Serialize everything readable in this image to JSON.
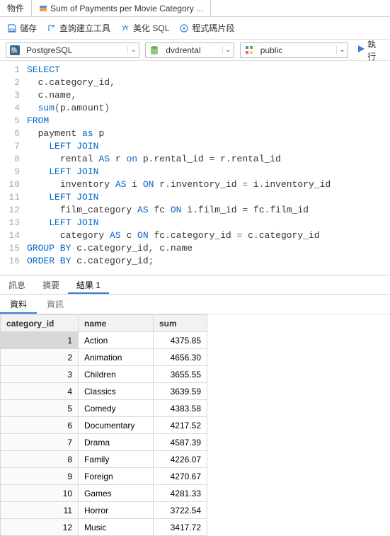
{
  "tabs_top": {
    "items": [
      "物件",
      "Sum of Payments per Movie Category ..."
    ],
    "active": 1
  },
  "toolbar": {
    "save": "儲存",
    "query_builder": "查詢建立工具",
    "beautify": "美化 SQL",
    "snippet": "程式碼片段"
  },
  "dropdowns": {
    "connection": "PostgreSQL",
    "database": "dvdrental",
    "schema": "public"
  },
  "run_label": "執行",
  "sql_lines": [
    [
      [
        "kw",
        "SELECT"
      ]
    ],
    [
      [
        "pad",
        "  "
      ],
      [
        "ident",
        "c"
      ],
      [
        "punc",
        "."
      ],
      [
        "ident",
        "category_id"
      ],
      [
        "punc",
        ","
      ]
    ],
    [
      [
        "pad",
        "  "
      ],
      [
        "ident",
        "c"
      ],
      [
        "punc",
        "."
      ],
      [
        "ident",
        "name"
      ],
      [
        "punc",
        ","
      ]
    ],
    [
      [
        "pad",
        "  "
      ],
      [
        "kw",
        "sum"
      ],
      [
        "punc",
        "("
      ],
      [
        "ident",
        "p"
      ],
      [
        "punc",
        "."
      ],
      [
        "ident",
        "amount"
      ],
      [
        "punc",
        ")"
      ]
    ],
    [
      [
        "kw",
        "FROM"
      ]
    ],
    [
      [
        "pad",
        "  "
      ],
      [
        "ident",
        "payment "
      ],
      [
        "kw",
        "as"
      ],
      [
        "ident",
        " p"
      ]
    ],
    [
      [
        "pad",
        "    "
      ],
      [
        "kw",
        "LEFT JOIN"
      ]
    ],
    [
      [
        "pad",
        "      "
      ],
      [
        "ident",
        "rental "
      ],
      [
        "kw",
        "AS"
      ],
      [
        "ident",
        " r "
      ],
      [
        "kw",
        "on"
      ],
      [
        "ident",
        " p"
      ],
      [
        "punc",
        "."
      ],
      [
        "ident",
        "rental_id "
      ],
      [
        "punc",
        "="
      ],
      [
        "ident",
        " r"
      ],
      [
        "punc",
        "."
      ],
      [
        "ident",
        "rental_id"
      ]
    ],
    [
      [
        "pad",
        "    "
      ],
      [
        "kw",
        "LEFT JOIN"
      ]
    ],
    [
      [
        "pad",
        "      "
      ],
      [
        "ident",
        "inventory "
      ],
      [
        "kw",
        "AS"
      ],
      [
        "ident",
        " i "
      ],
      [
        "kw",
        "ON"
      ],
      [
        "ident",
        " r"
      ],
      [
        "punc",
        "."
      ],
      [
        "ident",
        "inventory_id "
      ],
      [
        "punc",
        "="
      ],
      [
        "ident",
        " i"
      ],
      [
        "punc",
        "."
      ],
      [
        "ident",
        "inventory_id"
      ]
    ],
    [
      [
        "pad",
        "    "
      ],
      [
        "kw",
        "LEFT JOIN"
      ]
    ],
    [
      [
        "pad",
        "      "
      ],
      [
        "ident",
        "film_category "
      ],
      [
        "kw",
        "AS"
      ],
      [
        "ident",
        " fc "
      ],
      [
        "kw",
        "ON"
      ],
      [
        "ident",
        " i"
      ],
      [
        "punc",
        "."
      ],
      [
        "ident",
        "film_id "
      ],
      [
        "punc",
        "="
      ],
      [
        "ident",
        " fc"
      ],
      [
        "punc",
        "."
      ],
      [
        "ident",
        "film_id"
      ]
    ],
    [
      [
        "pad",
        "    "
      ],
      [
        "kw",
        "LEFT JOIN"
      ]
    ],
    [
      [
        "pad",
        "      "
      ],
      [
        "ident",
        "category "
      ],
      [
        "kw",
        "AS"
      ],
      [
        "ident",
        " c "
      ],
      [
        "kw",
        "ON"
      ],
      [
        "ident",
        " fc"
      ],
      [
        "punc",
        "."
      ],
      [
        "ident",
        "category_id "
      ],
      [
        "punc",
        "="
      ],
      [
        "ident",
        " c"
      ],
      [
        "punc",
        "."
      ],
      [
        "ident",
        "category_id"
      ]
    ],
    [
      [
        "kw",
        "GROUP BY"
      ],
      [
        "ident",
        " c"
      ],
      [
        "punc",
        "."
      ],
      [
        "ident",
        "category_id"
      ],
      [
        "punc",
        ","
      ],
      [
        "ident",
        " c"
      ],
      [
        "punc",
        "."
      ],
      [
        "ident",
        "name"
      ]
    ],
    [
      [
        "kw",
        "ORDER BY"
      ],
      [
        "ident",
        " c"
      ],
      [
        "punc",
        "."
      ],
      [
        "ident",
        "category_id"
      ],
      [
        "punc",
        ";"
      ]
    ]
  ],
  "result_tabs": {
    "items": [
      "訊息",
      "摘要",
      "結果 1"
    ],
    "active": 2
  },
  "sub_tabs": {
    "items": [
      "資料",
      "資訊"
    ],
    "active": 0
  },
  "grid": {
    "columns": [
      "category_id",
      "name",
      "sum"
    ],
    "rows": [
      {
        "id": 1,
        "name": "Action",
        "sum": "4375.85"
      },
      {
        "id": 2,
        "name": "Animation",
        "sum": "4656.30"
      },
      {
        "id": 3,
        "name": "Children",
        "sum": "3655.55"
      },
      {
        "id": 4,
        "name": "Classics",
        "sum": "3639.59"
      },
      {
        "id": 5,
        "name": "Comedy",
        "sum": "4383.58"
      },
      {
        "id": 6,
        "name": "Documentary",
        "sum": "4217.52"
      },
      {
        "id": 7,
        "name": "Drama",
        "sum": "4587.39"
      },
      {
        "id": 8,
        "name": "Family",
        "sum": "4226.07"
      },
      {
        "id": 9,
        "name": "Foreign",
        "sum": "4270.67"
      },
      {
        "id": 10,
        "name": "Games",
        "sum": "4281.33"
      },
      {
        "id": 11,
        "name": "Horror",
        "sum": "3722.54"
      },
      {
        "id": 12,
        "name": "Music",
        "sum": "3417.72"
      }
    ]
  }
}
